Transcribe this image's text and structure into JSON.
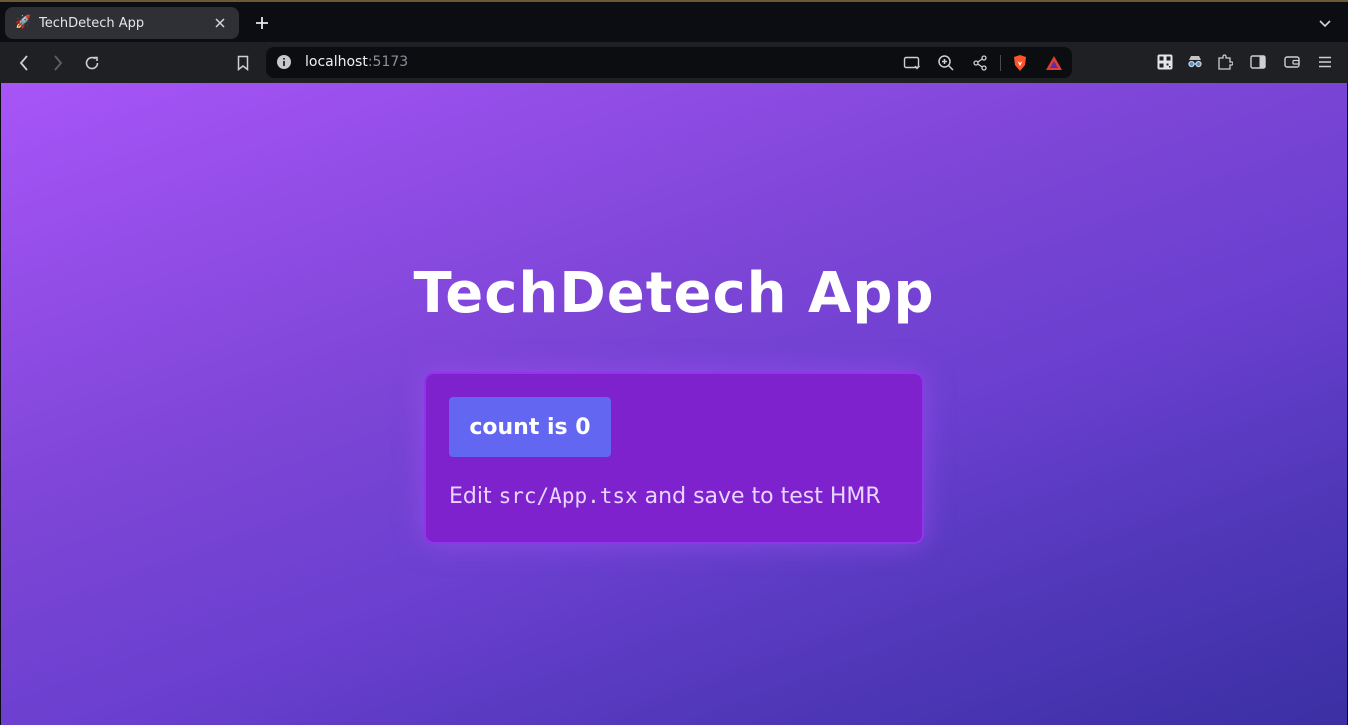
{
  "browser": {
    "tab": {
      "favicon": "rocket-icon",
      "title": "TechDetech App",
      "favicon_glyph": "🚀"
    },
    "url": {
      "host": "localhost",
      "port": ":5173"
    },
    "colors": {
      "tabstrip": "#0c0d12",
      "toolbar": "#1f2024",
      "omnibox": "#0c0d11"
    }
  },
  "page": {
    "title": "TechDetech App",
    "counter_button": "count is 0",
    "hint": {
      "prefix": "Edit ",
      "code": "src/App.tsx",
      "suffix": " and save to test HMR"
    },
    "colors": {
      "card": "#7e22ce",
      "button": "#6366f1",
      "gradient_start": "#a855f7",
      "gradient_end": "#3b2fa3"
    }
  }
}
